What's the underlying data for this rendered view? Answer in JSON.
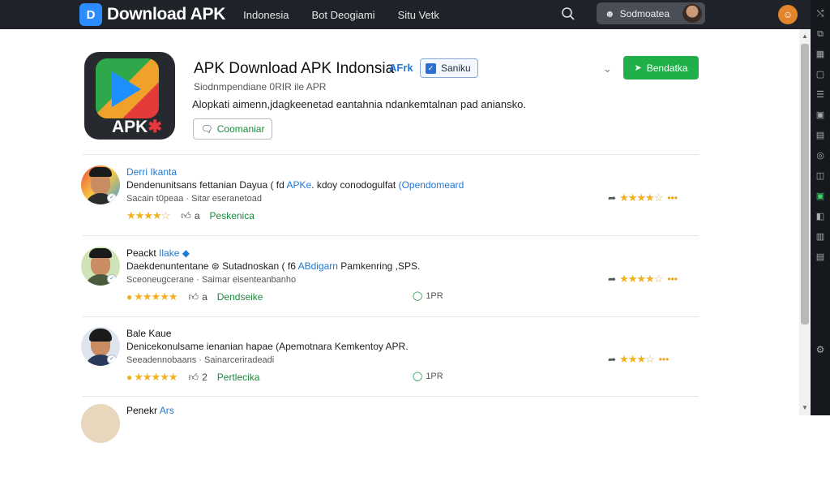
{
  "header": {
    "logo_mark": "D",
    "logo_text": "Download APK",
    "nav": [
      "Indonesia",
      "Bot Deogiami",
      "Situ  Vetk"
    ],
    "user_name": "Sodmoatea",
    "bell_glyph": "☺"
  },
  "app": {
    "title": "APK Download APK Indonsia",
    "tag_apk": "AFrk",
    "tag_button": "Saniku",
    "download_button": "Bendatka",
    "subtitle": "Siodnmpendiane 0RIR ile APR",
    "description": "Alopkati aimenn,jdagkeenetad eantahnia ndankemtalnan pad aniansko.",
    "comment_button": "Coomaniar",
    "icon_label": "APK",
    "icon_label_mark": "✱"
  },
  "reviews": [
    {
      "name": "Derri Ikanta",
      "verified": "",
      "text_pre": "Dendenunitsans fettanian Dayua ( fd ",
      "text_hl": "APKe",
      "text_mid": ". kdoy conodogulfat ",
      "text_hl2": "(Opendomeard",
      "meta": "Sacain t0peaa  · Sitar eseranetoad",
      "stars": "★★★★",
      "stars_empty": "☆",
      "star_badge": "",
      "like_count": "a",
      "reply": "Peskenica",
      "apk_label": "",
      "right_stars": "★★★★",
      "right_empty": "☆"
    },
    {
      "name": "Peackt",
      "verified": "Ilake ◆",
      "text_pre": "Daekdenuntentane ",
      "text_hl": "",
      "text_mid": "⊜ Sutadnoskan ( f6 ",
      "text_hl2": "ABdigarn",
      "text_post": " Pamkenring ,SPS.",
      "meta": "Sceoneugcerane  · Saimar eisenteanbanho",
      "stars": "★★★★★",
      "stars_empty": "",
      "star_badge": "●",
      "like_count": "a",
      "reply": "Dendseike",
      "apk_label": "1PR",
      "right_stars": "★★★★",
      "right_empty": "☆"
    },
    {
      "name": "Bale Kaue",
      "verified": "",
      "text_pre": "Denicekonulsame ienanian hapae (Apemotnara Kemkentoy APR.",
      "text_hl": "",
      "text_mid": "",
      "text_hl2": "",
      "meta": "Seeadennobaans  · Sainarceriradeadi",
      "stars": "★★★★★",
      "stars_empty": "",
      "star_badge": "●",
      "like_count": "2",
      "reply": "Pertlecika",
      "apk_label": "1PR",
      "right_stars": "★★★",
      "right_empty": "☆"
    },
    {
      "name": "Penekr",
      "verified": "Ars"
    }
  ],
  "colors": {
    "accent_green": "#1fb04a",
    "link_blue": "#2279d6",
    "star_gold": "#f2b01e",
    "topbar": "#1f2329"
  }
}
